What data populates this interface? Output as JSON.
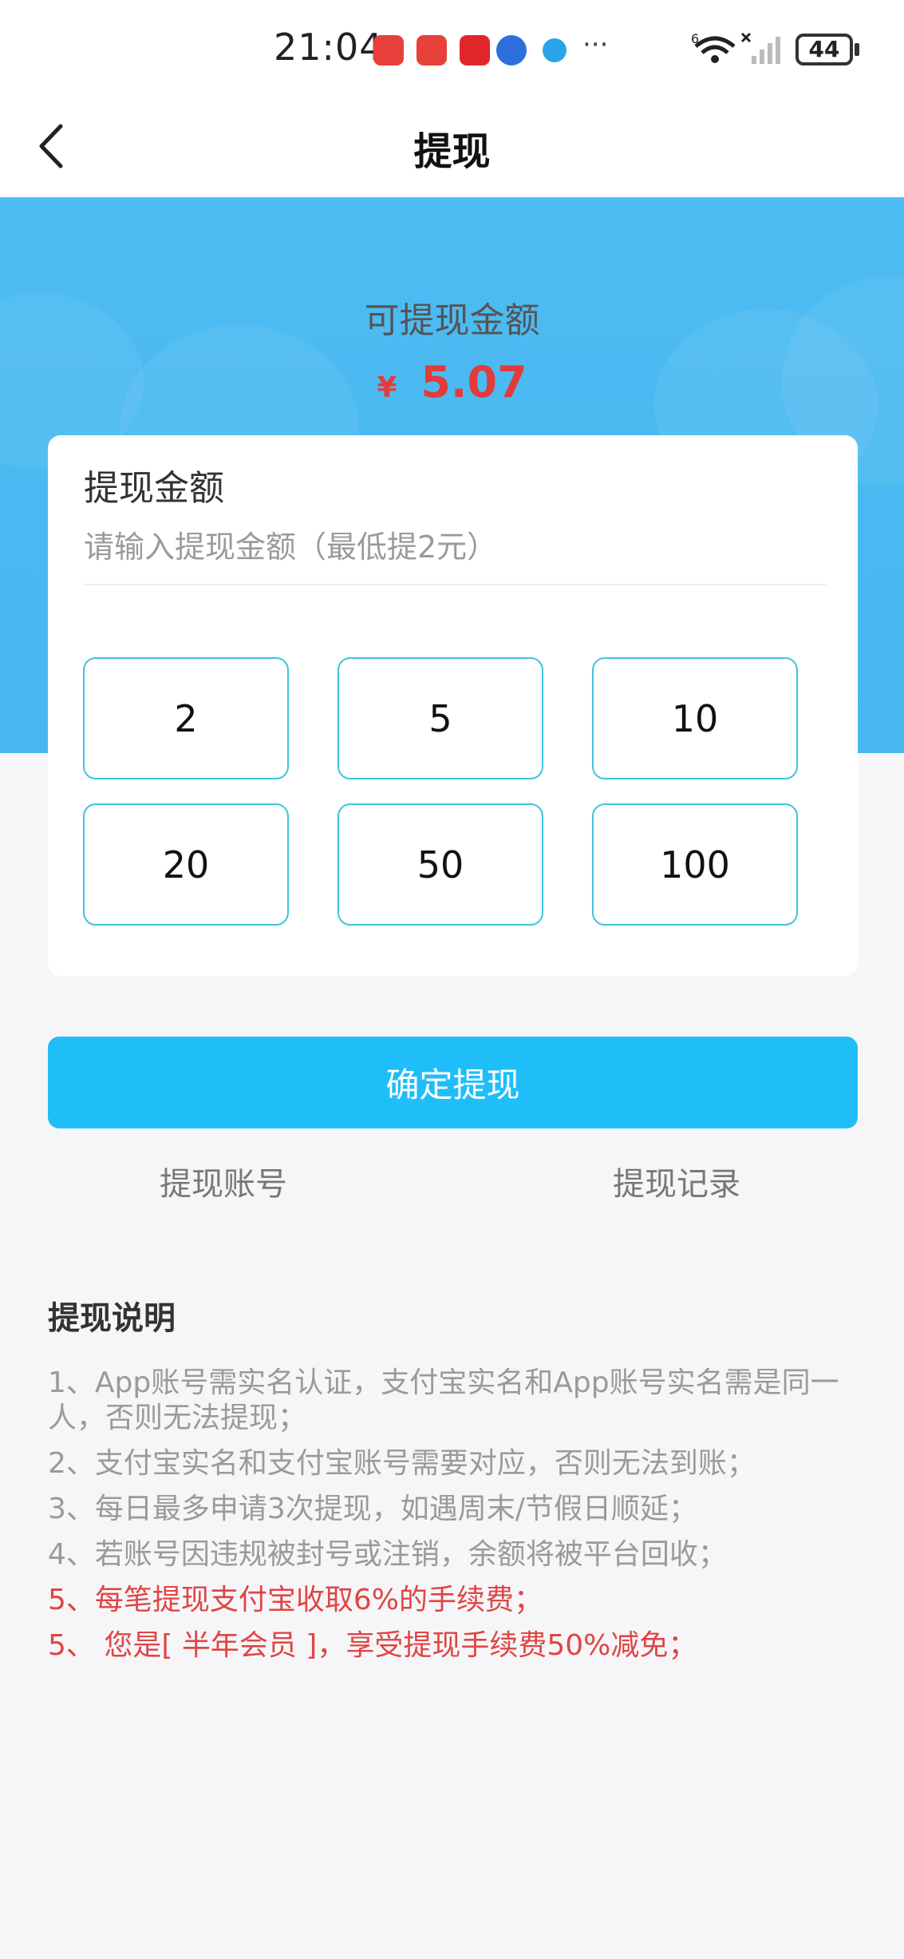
{
  "status_bar": {
    "time": "21:04",
    "more": "···",
    "network": "6",
    "battery": "44"
  },
  "nav": {
    "title": "提现"
  },
  "hero": {
    "label": "可提现金额",
    "currency": "¥",
    "amount": "5.07"
  },
  "card": {
    "title": "提现金额",
    "input_placeholder": "请输入提现金额（最低提2元）",
    "input_value": "",
    "options": [
      "2",
      "5",
      "10",
      "20",
      "50",
      "100"
    ]
  },
  "actions": {
    "confirm_label": "确定提现",
    "account_link": "提现账号",
    "records_link": "提现记录"
  },
  "notes": {
    "title": "提现说明",
    "items": [
      "1、App账号需实名认证，支付宝实名和App账号实名需是同一人，否则无法提现；",
      "2、支付宝实名和支付宝账号需要对应，否则无法到账；",
      "3、每日最多申请3次提现，如遇周末/节假日顺延；",
      "4、若账号因违规被封号或注销，余额将被平台回收；",
      "5、每笔提现支付宝收取6%的手续费；",
      "5、 您是[ 半年会员 ]，享受提现手续费50%减免；"
    ]
  },
  "colors": {
    "hero_bg": "#4dbcf2",
    "accent": "#1fbef9",
    "option_border": "#3fc3dd",
    "amount_red": "#e23b3b",
    "warning_red": "#e04545"
  }
}
